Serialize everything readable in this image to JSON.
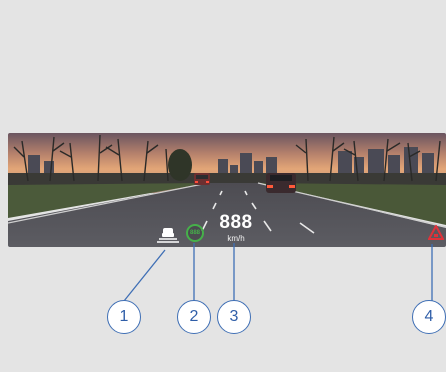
{
  "hud": {
    "speed_value": "888",
    "speed_unit": "km/h",
    "speed_limit": "888"
  },
  "callouts": [
    {
      "label": "1"
    },
    {
      "label": "2"
    },
    {
      "label": "3"
    },
    {
      "label": "4"
    }
  ],
  "icons": {
    "lane": "lane-departure-icon",
    "speed_limit": "speed-limit-icon",
    "warning": "forward-collision-warning-icon"
  },
  "colors": {
    "callout_stroke": "#3f6fb5",
    "speed_limit_ring": "#46b04a",
    "warning": "#e0323a",
    "background": "#e4e4e4"
  }
}
